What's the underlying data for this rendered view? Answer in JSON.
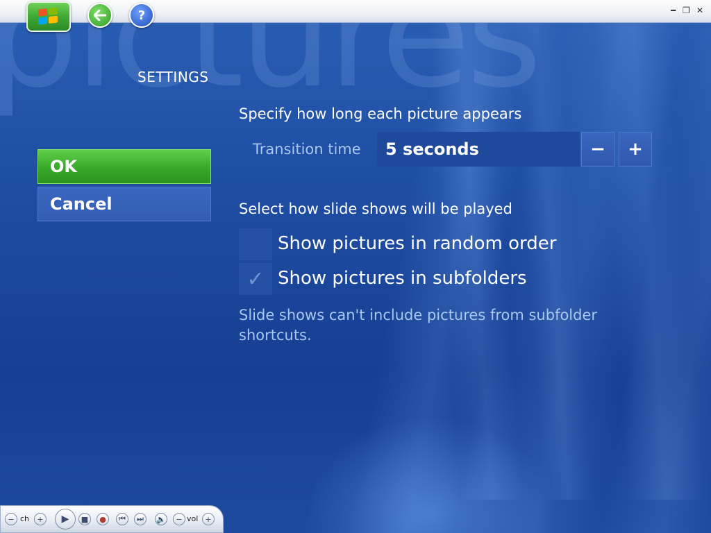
{
  "watermark": "pictures",
  "page_title": "SETTINGS",
  "nav": {
    "ok_label": "OK",
    "cancel_label": "Cancel"
  },
  "transition": {
    "heading": "Specify how long each picture appears",
    "label": "Transition time",
    "value": "5 seconds",
    "minus": "−",
    "plus": "+"
  },
  "slideshow": {
    "heading": "Select how slide shows will be played",
    "options": [
      {
        "label": "Show pictures in random order",
        "checked": false
      },
      {
        "label": "Show pictures in subfolders",
        "checked": true
      }
    ],
    "note": "Slide shows can't include pictures from subfolder shortcuts."
  },
  "transport": {
    "ch_label": "ch",
    "vol_label": "vol"
  },
  "colors": {
    "ok_green": "#38a82a",
    "background_blue": "#1e4da3",
    "muted_text": "#a9c8ef"
  }
}
